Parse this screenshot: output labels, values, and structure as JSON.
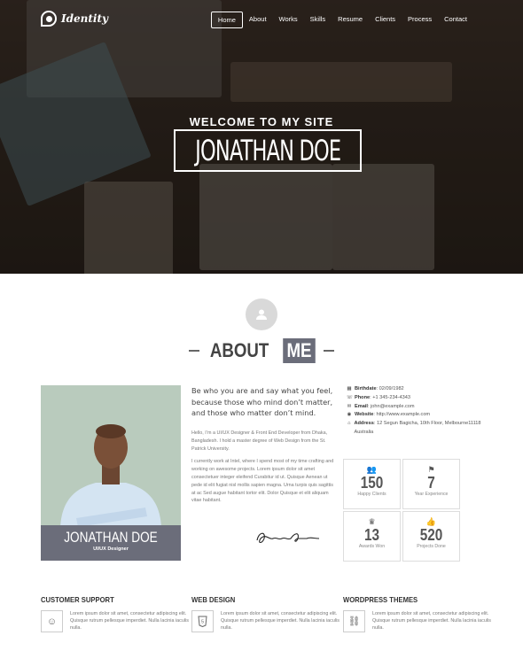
{
  "nav": {
    "logo": "Identity",
    "items": [
      {
        "label": "Home",
        "active": true
      },
      {
        "label": "About"
      },
      {
        "label": "Works"
      },
      {
        "label": "Skills"
      },
      {
        "label": "Resume"
      },
      {
        "label": "Clients"
      },
      {
        "label": "Process"
      },
      {
        "label": "Contact"
      }
    ]
  },
  "hero": {
    "welcome": "WELCOME TO MY SITE",
    "name": "JONATHAN DOE"
  },
  "about": {
    "icon": "user-icon",
    "title_a": "ABOUT",
    "title_b": "ME",
    "photo_name": "JONATHAN DOE",
    "photo_role": "UI/UX Designer",
    "quote": "Be who you are and say what you feel, because those who mind don’t matter, and those who matter don’t mind.",
    "bio": [
      "Hello, I’m a UI/UX Designer & Front End Developer from Dhaka, Bangladesh. I hold a master degree of Web Design from the St. Patrick University.",
      "I currently work at Intel, where I spend most of my time crafting and working on awesome projects. Lorem ipsum dolor sit amet consectetuer integer eleifend Curabitur id ut. Quisque Aenean ut pede id elit fugiat nisl mollis sapien magna. Urna turpis quis sagittis at ac Sed augue habitant tortor elit. Dolor Quisque et elit aliquam vitae habitant."
    ],
    "info": [
      {
        "icon": "calendar-icon",
        "key": "Birthdate",
        "value": ": 02/09/1982"
      },
      {
        "icon": "phone-icon",
        "key": "Phone",
        "value": ": +1 345-234-4343"
      },
      {
        "icon": "envelope-icon",
        "key": "Email",
        "value": ": john@example.com"
      },
      {
        "icon": "globe-icon",
        "key": "Website",
        "value": ": http://www.example.com"
      },
      {
        "icon": "home-icon",
        "key": "Address",
        "value": ": 12 Segun Bagicha, 10th Floor, Melbourne11118 Australia"
      }
    ],
    "stats": [
      {
        "icon": "users-icon",
        "value": "150",
        "label": "Happy Clients"
      },
      {
        "icon": "flag-icon",
        "value": "7",
        "label": "Year Experience"
      },
      {
        "icon": "trophy-icon",
        "value": "13",
        "label": "Awards Won"
      },
      {
        "icon": "thumbs-up-icon",
        "value": "520",
        "label": "Projects Done"
      }
    ]
  },
  "services": [
    {
      "title": "CUSTOMER SUPPORT",
      "icon": "smile-icon",
      "text": "Lorem ipsum dolor sit amet, consectetur adipiscing elit. Quisque rutrum pellesque imperdiet. Nulla lacinia iaculis nulla."
    },
    {
      "title": "WEB DESIGN",
      "icon": "html5-icon",
      "text": "Lorem ipsum dolor sit amet, consectetur adipiscing elit. Quisque rutrum pellesque imperdiet. Nulla lacinia iaculis nulla."
    },
    {
      "title": "WORDPRESS THEMES",
      "icon": "link-icon",
      "text": "Lorem ipsum dolor sit amet, consectetur adipiscing elit. Quisque rutrum pellesque imperdiet. Nulla lacinia iaculis nulla."
    }
  ]
}
